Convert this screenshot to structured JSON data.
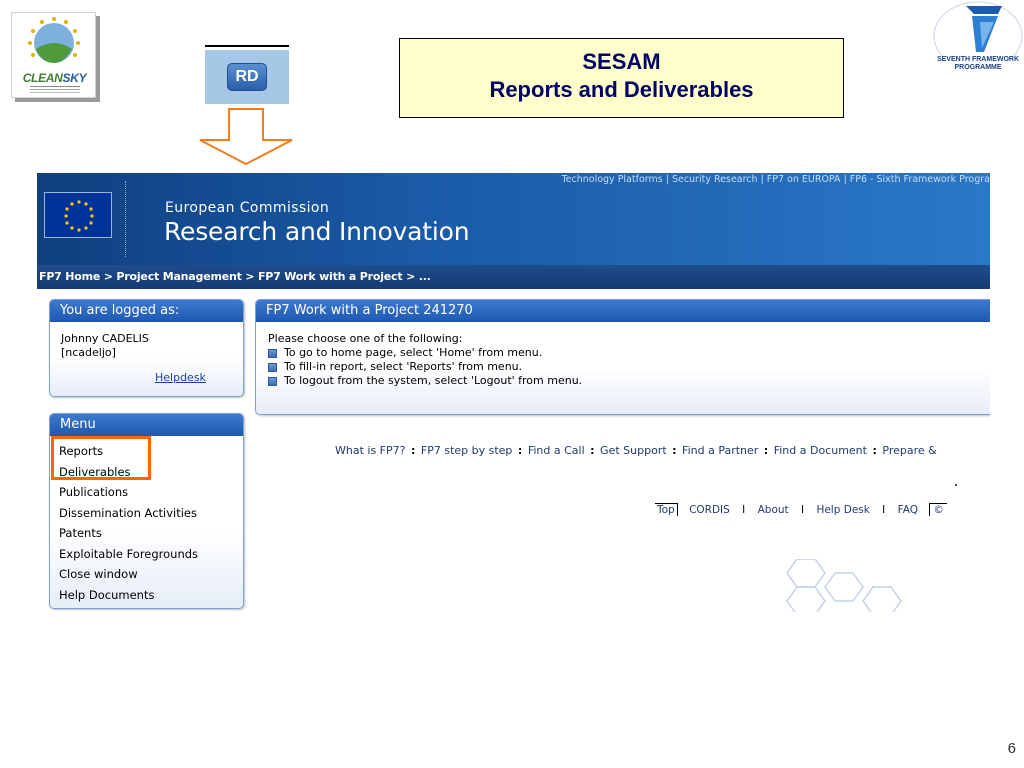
{
  "slide": {
    "title_line1": "SESAM",
    "title_line2": "Reports and Deliverables",
    "page_number": "6",
    "cleansky_logo_text_part1": "CLEAN",
    "cleansky_logo_text_part2": "SKY",
    "rd_logo_text": "RD",
    "fp7_logo_line1": "SEVENTH FRAMEWORK",
    "fp7_logo_line2": "PROGRAMME",
    "arrow_color": "#f07c22"
  },
  "banner": {
    "top_links": "Technology Platforms | Security Research | FP7 on EUROPA | FP6 - Sixth Framework Progra",
    "org_name": "European Commission",
    "dg_name": "Research and Innovation"
  },
  "breadcrumb": "FP7 Home  > Project Management  > FP7 Work with a Project  > ...",
  "login": {
    "header": "You are logged as:",
    "user_name": "Johnny CADELIS",
    "user_login": "[ncadeljo]",
    "helpdesk": "Helpdesk"
  },
  "menu": {
    "header": "Menu",
    "items": [
      "Reports",
      "Deliverables",
      "Publications",
      "Dissemination Activities",
      "Patents",
      "Exploitable Foregrounds",
      "Close window",
      "Help Documents"
    ],
    "highlight_color": "#ff6600"
  },
  "work": {
    "header": "FP7 Work with a Project 241270",
    "intro": "Please choose one of the following:",
    "items": [
      "To go to home page, select 'Home' from menu.",
      "To fill-in report, select 'Reports' from menu.",
      "To logout from the system, select 'Logout' from menu."
    ]
  },
  "footer_links": [
    "What is FP7?",
    "FP7 step by step",
    "Find a Call",
    "Get Support",
    "Find a Partner",
    "Find a Document",
    "Prepare &"
  ],
  "footer_sep": ":",
  "bottom_links": {
    "top": "Top",
    "cordis": "CORDIS",
    "about": "About",
    "helpdesk": "Help Desk",
    "faq": "FAQ",
    "copyright": "©",
    "pipe": "I"
  }
}
